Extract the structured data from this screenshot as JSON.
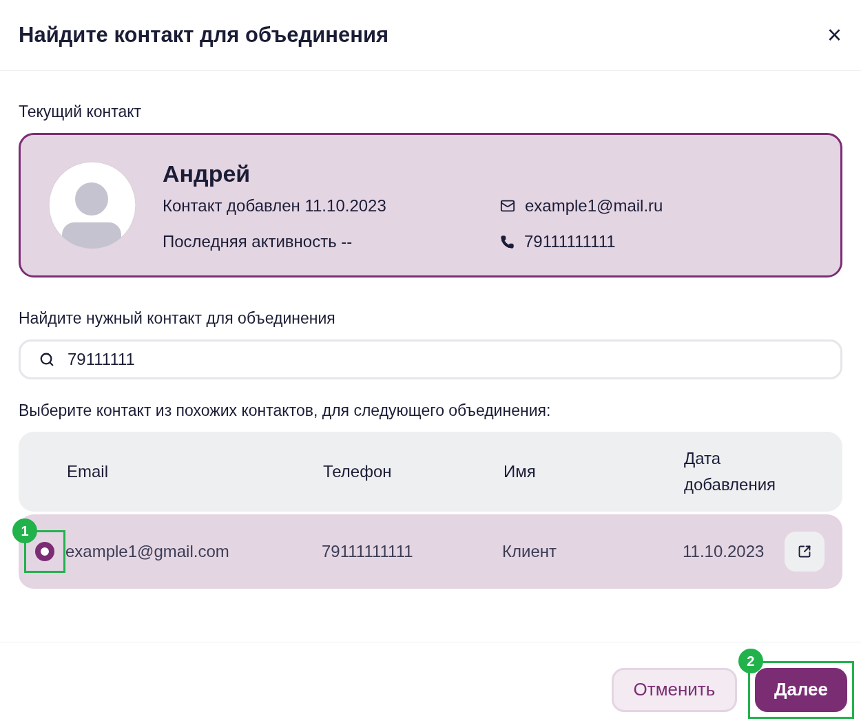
{
  "dialog": {
    "title": "Найдите контакт для объединения",
    "close": "×"
  },
  "current": {
    "label": "Текущий контакт",
    "name": "Андрей",
    "added": "Контакт добавлен 11.10.2023",
    "activity": "Последняя активность --",
    "email": "example1@mail.ru",
    "phone": "79111111111"
  },
  "search": {
    "label": "Найдите нужный контакт для объединения",
    "value": "79111111"
  },
  "results": {
    "label": "Выберите контакт из похожих контактов, для следующего объединения:",
    "columns": [
      "Email",
      "Телефон",
      "Имя",
      "Дата добавления"
    ],
    "rows": [
      {
        "selected": true,
        "step": "1",
        "cells": [
          "example1@gmail.com",
          "79111111111",
          "Клиент",
          "11.10.2023"
        ]
      }
    ]
  },
  "buttons": [
    {
      "label": "Отменить",
      "kind": "secondary"
    },
    {
      "label": "Далее",
      "kind": "primary",
      "step": "2"
    }
  ]
}
